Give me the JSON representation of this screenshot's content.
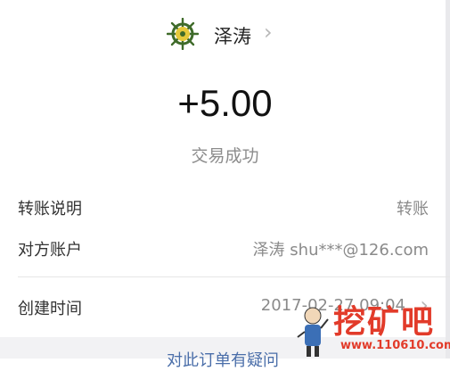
{
  "header": {
    "payee_name": "泽涛",
    "avatar_icon": "ship-wheel-icon",
    "chevron_icon": "chevron-right-icon"
  },
  "transaction": {
    "amount": "+5.00",
    "status": "交易成功"
  },
  "details": [
    {
      "label": "转账说明",
      "value": "转账"
    },
    {
      "label": "对方账户",
      "value": "泽涛 shu***@126.com"
    },
    {
      "label": "创建时间",
      "value": "2017-02-27 09:04"
    }
  ],
  "footer": {
    "link_text": "对此订单有疑问"
  },
  "watermark": {
    "brand": "挖矿吧",
    "url": "www.110610.com"
  },
  "colors": {
    "link": "#4a6ea9",
    "watermark": "#e23b2a"
  }
}
